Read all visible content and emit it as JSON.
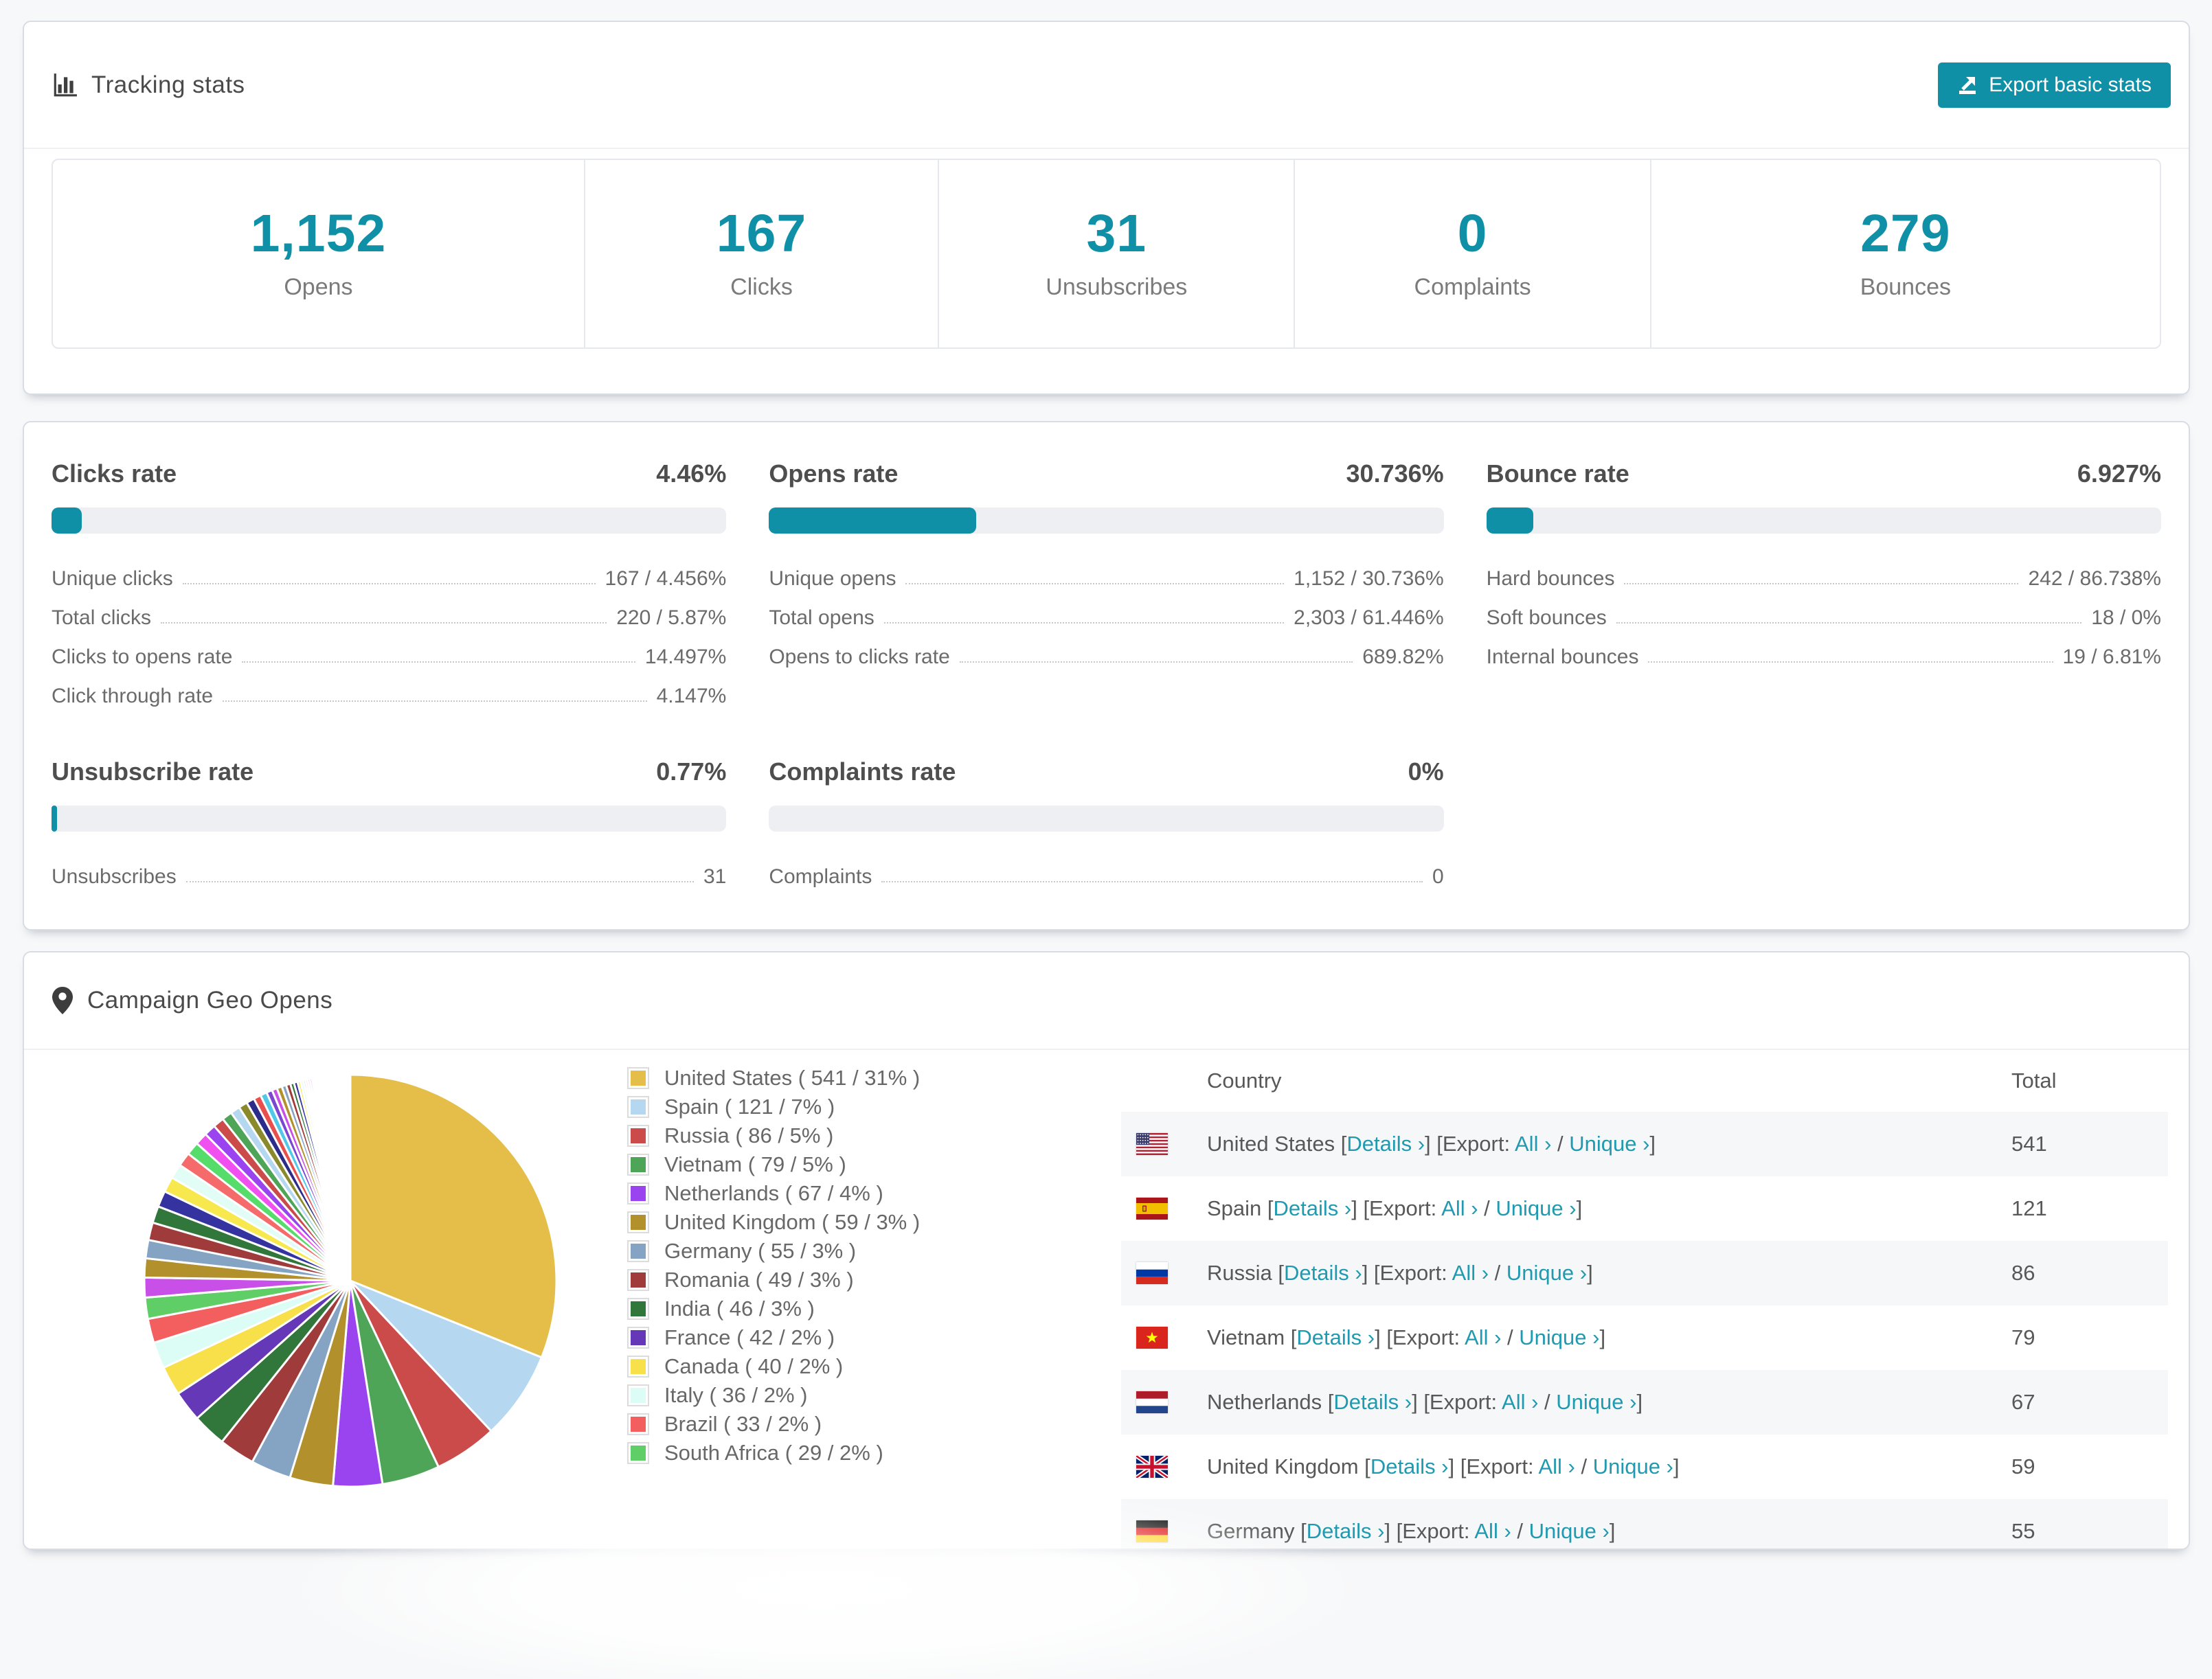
{
  "colors": {
    "accent": "#0f90a7",
    "link": "#1f9ab0"
  },
  "tracking": {
    "title": "Tracking stats",
    "export_label": "Export basic stats",
    "stats": [
      {
        "value": "1,152",
        "label": "Opens"
      },
      {
        "value": "167",
        "label": "Clicks"
      },
      {
        "value": "31",
        "label": "Unsubscribes"
      },
      {
        "value": "0",
        "label": "Complaints"
      },
      {
        "value": "279",
        "label": "Bounces"
      }
    ]
  },
  "rates": [
    {
      "title": "Clicks rate",
      "value": "4.46%",
      "percent": 4.46,
      "rows": [
        {
          "label": "Unique clicks",
          "value": "167 / 4.456%"
        },
        {
          "label": "Total clicks",
          "value": "220 / 5.87%"
        },
        {
          "label": "Clicks to opens rate",
          "value": "14.497%"
        },
        {
          "label": "Click through rate",
          "value": "4.147%"
        }
      ]
    },
    {
      "title": "Opens rate",
      "value": "30.736%",
      "percent": 30.736,
      "rows": [
        {
          "label": "Unique opens",
          "value": "1,152 / 30.736%"
        },
        {
          "label": "Total opens",
          "value": "2,303 / 61.446%"
        },
        {
          "label": "Opens to clicks rate",
          "value": "689.82%"
        }
      ]
    },
    {
      "title": "Bounce rate",
      "value": "6.927%",
      "percent": 6.927,
      "rows": [
        {
          "label": "Hard bounces",
          "value": "242 / 86.738%"
        },
        {
          "label": "Soft bounces",
          "value": "18 / 0%"
        },
        {
          "label": "Internal bounces",
          "value": "19 / 6.81%"
        }
      ]
    },
    {
      "title": "Unsubscribe rate",
      "value": "0.77%",
      "percent": 0.77,
      "rows": [
        {
          "label": "Unsubscribes",
          "value": "31"
        }
      ]
    },
    {
      "title": "Complaints rate",
      "value": "0%",
      "percent": 0,
      "rows": [
        {
          "label": "Complaints",
          "value": "0"
        }
      ]
    }
  ],
  "geo": {
    "title": "Campaign Geo Opens",
    "table": {
      "columns": [
        "Country",
        "Total"
      ],
      "links": {
        "details": "Details ›",
        "export_prefix": "Export:",
        "all": "All ›",
        "unique": "Unique ›"
      },
      "rows": [
        {
          "flag": "us",
          "country": "United States",
          "total": "541"
        },
        {
          "flag": "es",
          "country": "Spain",
          "total": "121"
        },
        {
          "flag": "ru",
          "country": "Russia",
          "total": "86"
        },
        {
          "flag": "vn",
          "country": "Vietnam",
          "total": "79"
        },
        {
          "flag": "nl",
          "country": "Netherlands",
          "total": "67"
        },
        {
          "flag": "gb",
          "country": "United Kingdom",
          "total": "59"
        },
        {
          "flag": "de",
          "country": "Germany",
          "total": "55"
        }
      ]
    }
  },
  "chart_data": {
    "type": "pie",
    "title": "Campaign Geo Opens",
    "legend_position": "right",
    "start_angle_deg": -90,
    "direction": "clockwise",
    "labels": [
      "United States",
      "Spain",
      "Russia",
      "Vietnam",
      "Netherlands",
      "United Kingdom",
      "Germany",
      "Romania",
      "India",
      "France",
      "Canada",
      "Italy",
      "Brazil",
      "South Africa"
    ],
    "values": [
      541,
      121,
      86,
      79,
      67,
      59,
      55,
      49,
      46,
      42,
      40,
      36,
      33,
      29
    ],
    "percents": [
      "31%",
      "7%",
      "5%",
      "5%",
      "4%",
      "3%",
      "3%",
      "3%",
      "3%",
      "2%",
      "2%",
      "2%",
      "2%",
      "2%"
    ],
    "colors": [
      "#e4be49",
      "#b5d7f0",
      "#cb4a4a",
      "#4fa557",
      "#9944ee",
      "#b2902c",
      "#85a4c4",
      "#a03b3b",
      "#31763a",
      "#6438b6",
      "#f8e04b",
      "#dcfcf6",
      "#f35f5f",
      "#5fce66"
    ],
    "others": {
      "note": "unlabeled small countries, taper to hairline slivers",
      "values": [
        27,
        26,
        25,
        24,
        23,
        22,
        21,
        20,
        19,
        18,
        17,
        16,
        15,
        14,
        13,
        12,
        11,
        10,
        9,
        8,
        7,
        7,
        6,
        6,
        5,
        5,
        4,
        4,
        3,
        3,
        3,
        3,
        2,
        2,
        2,
        2,
        2,
        2,
        2,
        2,
        2,
        1,
        1,
        1,
        1,
        1,
        1,
        1,
        1,
        1,
        1,
        1,
        1,
        1,
        1,
        1,
        1,
        1,
        1,
        1,
        1,
        1,
        1,
        1,
        1,
        1,
        1,
        1,
        1,
        1,
        1,
        1,
        1,
        1,
        1
      ],
      "palette": [
        "#c850e8",
        "#b2902c",
        "#85a4c4",
        "#a03b3b",
        "#31763a",
        "#3433a0",
        "#f6e84d",
        "#e2fcf6",
        "#f56a6a",
        "#55dc6a",
        "#ef50ef",
        "#9944ee",
        "#cb4a4a",
        "#4fa557",
        "#b5d7f0",
        "#8a8a2c",
        "#2c2c8a",
        "#e85050",
        "#50c8e8",
        "#7a46d2"
      ]
    }
  }
}
